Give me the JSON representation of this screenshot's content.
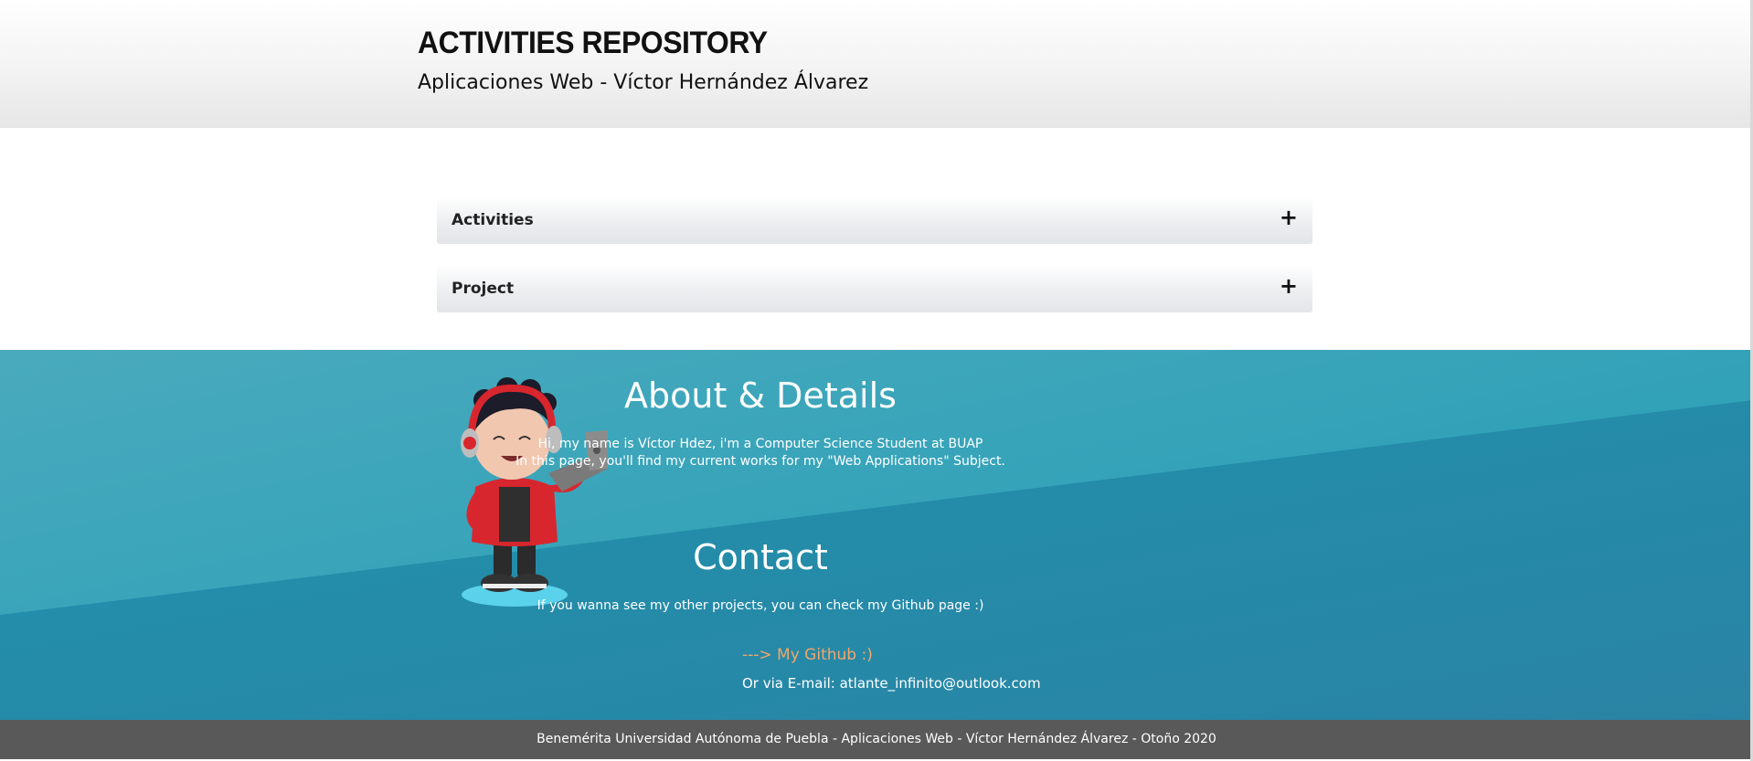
{
  "header": {
    "title": "ACTIVITIES REPOSITORY",
    "subtitle": "Aplicaciones Web - Víctor Hernández Álvarez"
  },
  "accordion": {
    "items": [
      {
        "label": "Activities",
        "icon": "plus-icon",
        "symbol": "+"
      },
      {
        "label": "Project",
        "icon": "plus-icon",
        "symbol": "+"
      }
    ]
  },
  "about": {
    "title": "About & Details",
    "line1": "Hi, my name is Víctor Hdez, i'm a Computer Science Student at BUAP",
    "line2": "In this page, you'll find my current works for my \"Web Applications\" Subject."
  },
  "contact": {
    "title": "Contact",
    "text": "If you wanna see my other projects, you can check my Github page :)",
    "github_link": "---> My Github :)",
    "email": "Or via E-mail: atlante_infinito@outlook.com"
  },
  "footer": {
    "text": "Benemérita Universidad Autónoma de Puebla - Aplicaciones Web - Víctor Hernández Álvarez - Otoño 2020"
  },
  "colors": {
    "section_bg": "#1f8aa3",
    "link": "#f2a66b",
    "footer_bg": "#595959"
  }
}
